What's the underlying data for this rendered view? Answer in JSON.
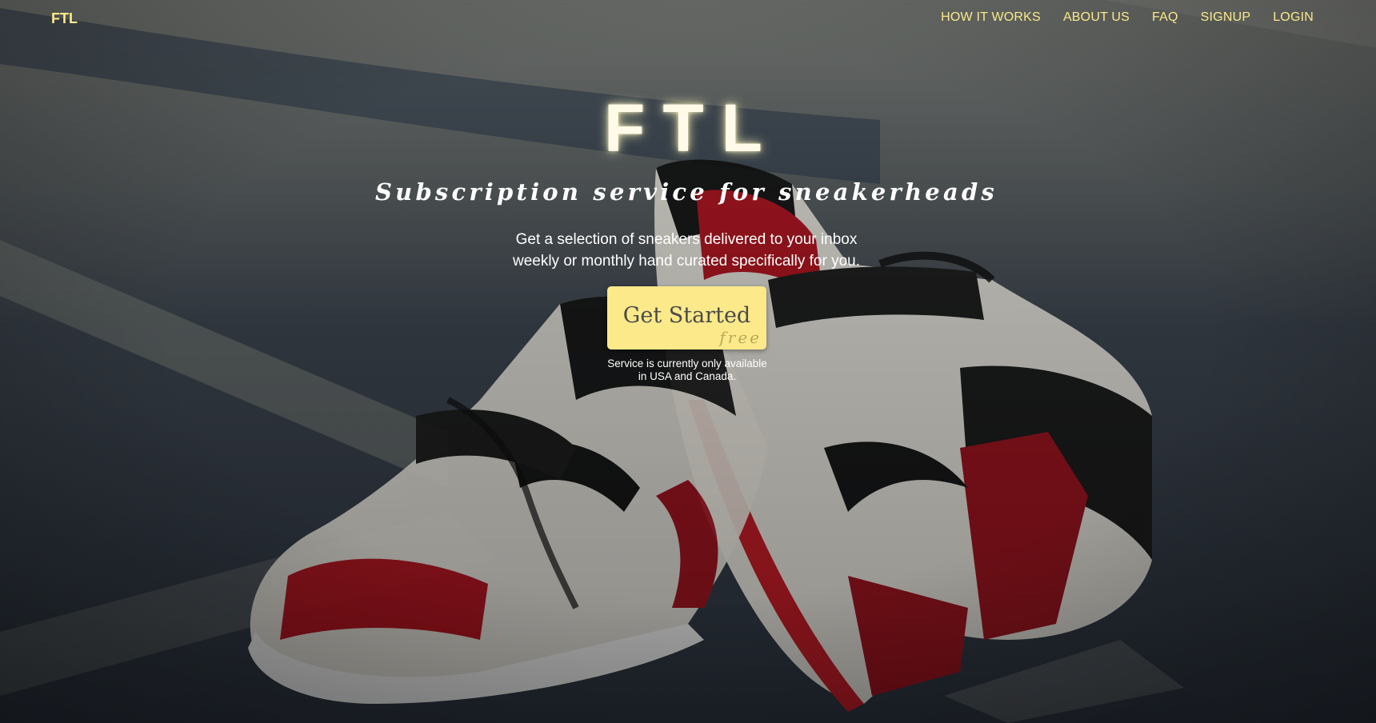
{
  "nav": {
    "brand": "FTL",
    "links": [
      {
        "label": "HOW IT WORKS"
      },
      {
        "label": "ABOUT US"
      },
      {
        "label": "FAQ"
      },
      {
        "label": "SIGNUP"
      },
      {
        "label": "LOGIN"
      }
    ]
  },
  "hero": {
    "title": "FTL",
    "subtitle": "Subscription service for sneakerheads",
    "description_line1": "Get a selection of sneakers delivered to your inbox",
    "description_line2": "weekly or monthly hand curated specifically for you.",
    "cta_label": "Get Started",
    "cta_sublabel": "free",
    "availability_line1": "Service is currently only available",
    "availability_line2": "in USA and Canada."
  },
  "colors": {
    "accent": "#fbe98a",
    "text": "#ffffff",
    "button_text": "#4a4a4a"
  }
}
